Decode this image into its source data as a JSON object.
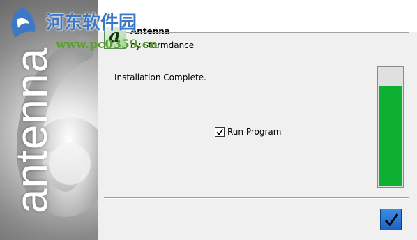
{
  "watermark": {
    "title": "河东软件园",
    "url": "www.pc0359.cn"
  },
  "banner": {
    "vertical_text": "antenna",
    "big_glyph": "6"
  },
  "app": {
    "icon_letter": "a",
    "name": "Antenna",
    "by": "by Stormdance"
  },
  "main": {
    "status_text": "Installation Complete.",
    "run_program_label": "Run Program",
    "run_program_checked": true
  },
  "progress": {
    "value_percent": 85,
    "fill_color": "#0db030"
  },
  "colors": {
    "accent": "#1c63c2",
    "watermark_title": "#3d78c6",
    "watermark_url": "#5a9f2f"
  },
  "icons": {
    "finish": "checkmark-icon",
    "watermark": "watermark-logo-icon",
    "app": "app-logo-icon"
  }
}
